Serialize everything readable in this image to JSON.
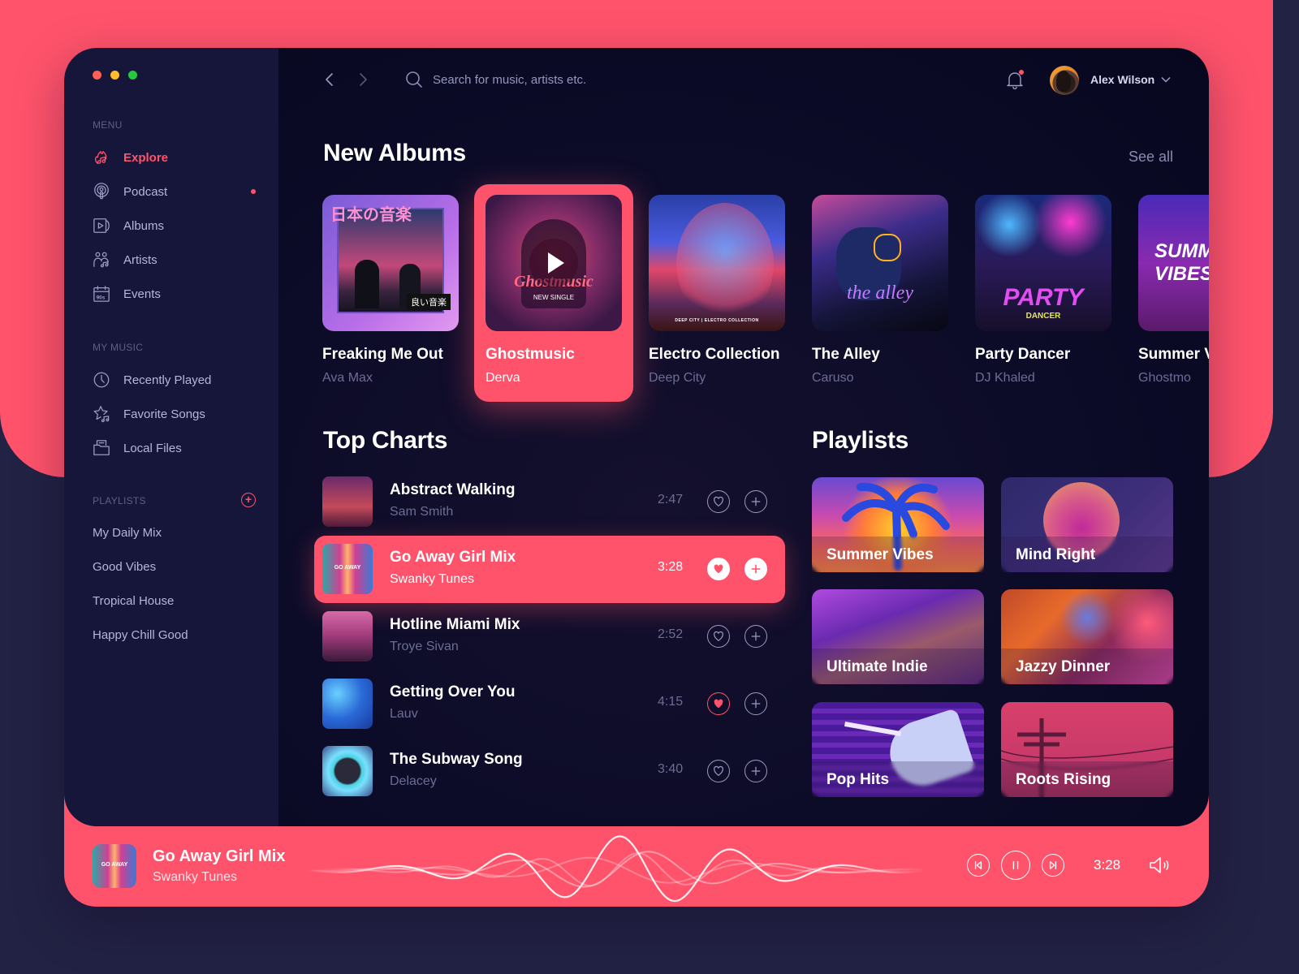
{
  "colors": {
    "accent": "#ff536b",
    "sidebar_bg": "#15163a",
    "main_bg": "#0b0b27",
    "page_bg_bottom": "#222244",
    "traffic_red": "#fe5f57",
    "traffic_yellow": "#febc2e",
    "traffic_green": "#28c840"
  },
  "sidebar": {
    "menu_label": "MENU",
    "menu_items": [
      {
        "label": "Explore",
        "icon": "music-fire-icon",
        "active": true
      },
      {
        "label": "Podcast",
        "icon": "podcast-icon",
        "badge": true
      },
      {
        "label": "Albums",
        "icon": "album-icon"
      },
      {
        "label": "Artists",
        "icon": "artists-icon"
      },
      {
        "label": "Events",
        "icon": "calendar-icon"
      }
    ],
    "my_music_label": "MY MUSIC",
    "my_music_items": [
      {
        "label": "Recently Played",
        "icon": "clock-icon"
      },
      {
        "label": "Favorite Songs",
        "icon": "star-music-icon"
      },
      {
        "label": "Local Files",
        "icon": "folder-icon"
      }
    ],
    "playlists_label": "PLAYLISTS",
    "add_playlist_icon": "plus-circle-icon",
    "playlists": [
      "My Daily Mix",
      "Good Vibes",
      "Tropical House",
      "Happy Chill Good"
    ]
  },
  "topbar": {
    "search_placeholder": "Search for music, artists etc.",
    "user_name": "Alex Wilson",
    "notification_badge": true
  },
  "new_albums": {
    "title": "New Albums",
    "see_all": "See all",
    "items": [
      {
        "title": "Freaking Me Out",
        "artist": "Ava Max",
        "cover_text": "日本の音楽",
        "cover_sub": "良い音楽"
      },
      {
        "title": "Ghostmusic",
        "artist": "Derva",
        "cover_text": "Ghostmusic",
        "cover_sub": "NEW SINGLE",
        "active": true
      },
      {
        "title": "Electro Collection",
        "artist": "Deep City",
        "cover_text": "DEEP CITY | ELECTRO COLLECTION"
      },
      {
        "title": "The Alley",
        "artist": "Caruso",
        "cover_text": "the alley"
      },
      {
        "title": "Party Dancer",
        "artist": "DJ Khaled",
        "cover_text": "PARTY",
        "cover_sub": "DANCER"
      },
      {
        "title": "Summer Vibes",
        "artist": "Ghostmo",
        "cover_text": "SUMMER VIBES"
      }
    ]
  },
  "top_charts": {
    "title": "Top Charts",
    "tracks": [
      {
        "title": "Abstract Walking",
        "artist": "Sam Smith",
        "duration": "2:47",
        "liked": false
      },
      {
        "title": "Go Away Girl Mix",
        "artist": "Swanky Tunes",
        "duration": "3:28",
        "liked": true,
        "active": true
      },
      {
        "title": "Hotline Miami Mix",
        "artist": "Troye Sivan",
        "duration": "2:52",
        "liked": false
      },
      {
        "title": "Getting Over You",
        "artist": "Lauv",
        "duration": "4:15",
        "liked": true
      },
      {
        "title": "The Subway Song",
        "artist": "Delacey",
        "duration": "3:40",
        "liked": false
      }
    ]
  },
  "playlists": {
    "title": "Playlists",
    "items": [
      "Summer Vibes",
      "Mind Right",
      "Ultimate Indie",
      "Jazzy Dinner",
      "Pop Hits",
      "Roots Rising"
    ]
  },
  "player": {
    "title": "Go Away Girl Mix",
    "artist": "Swanky Tunes",
    "thumb_text": "GO AWAY",
    "time": "3:28",
    "state": "playing"
  }
}
